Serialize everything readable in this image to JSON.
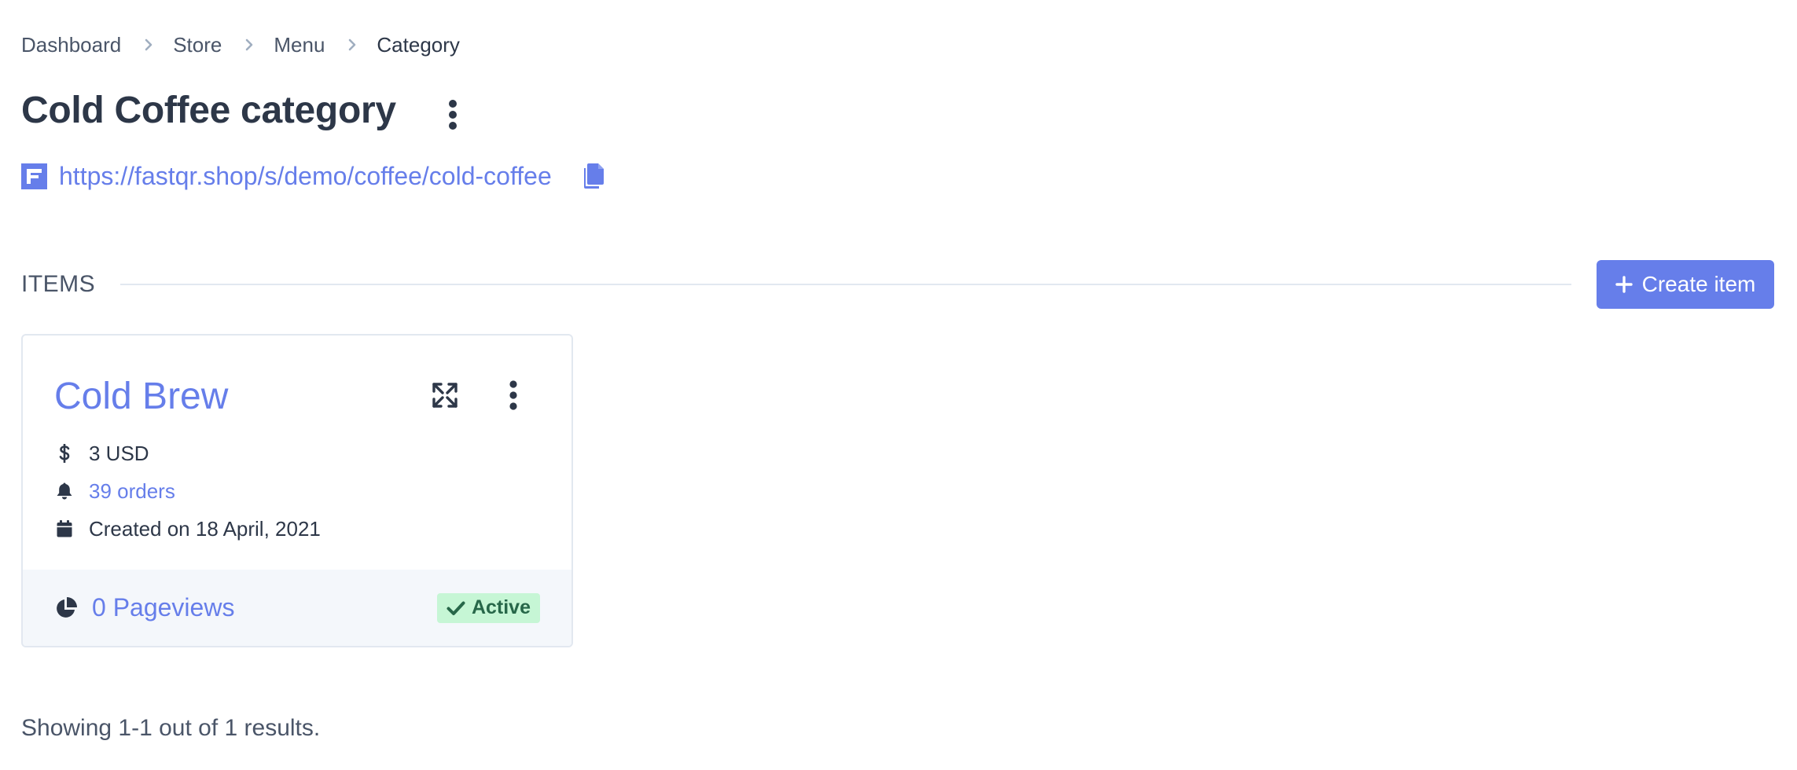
{
  "breadcrumb": {
    "items": [
      "Dashboard",
      "Store",
      "Menu",
      "Category"
    ]
  },
  "header": {
    "title": "Cold Coffee category",
    "url": "https://fastqr.shop/s/demo/coffee/cold-coffee"
  },
  "items_section": {
    "title": "ITEMS",
    "create_label": "Create item"
  },
  "item_card": {
    "name": "Cold Brew",
    "price": "3 USD",
    "orders": "39 orders",
    "created": "Created on 18 April, 2021",
    "pageviews": "0 Pageviews",
    "status": "Active"
  },
  "pagination": {
    "summary": "Showing 1-1 out of 1 results."
  },
  "colors": {
    "accent": "#667eea",
    "text": "#2d3748",
    "muted": "#4a5568",
    "badge_bg": "#c6f6d5",
    "badge_text": "#276749",
    "footer_bg": "#f4f7fb"
  },
  "icons": {
    "breadcrumb_separator": "chevron-right-icon",
    "menu": "kebab-menu-icon",
    "brand": "fastqr-logo",
    "copy": "copy-icon",
    "create": "plus-icon",
    "expand": "expand-icon",
    "price": "dollar-icon",
    "orders": "bell-icon",
    "created": "calendar-icon",
    "pageviews": "pie-chart-icon",
    "status": "check-icon"
  }
}
